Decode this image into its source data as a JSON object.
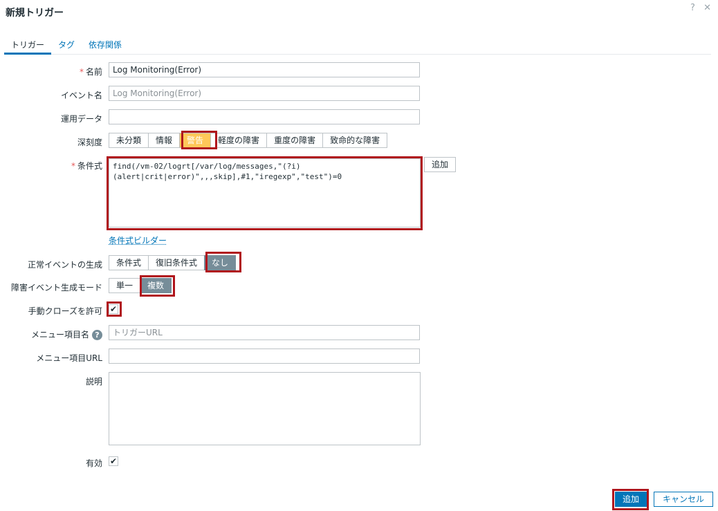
{
  "dialog": {
    "title": "新規トリガー",
    "help_icon": "?",
    "close_icon": "✕"
  },
  "tabs": [
    "トリガー",
    "タグ",
    "依存関係"
  ],
  "form": {
    "name": {
      "label": "名前",
      "value": "Log Monitoring(Error)"
    },
    "event_name": {
      "label": "イベント名",
      "placeholder": "Log Monitoring(Error)"
    },
    "opdata": {
      "label": "運用データ",
      "value": ""
    },
    "severity": {
      "label": "深刻度",
      "options": [
        "未分類",
        "情報",
        "警告",
        "軽度の障害",
        "重度の障害",
        "致命的な障害"
      ],
      "selected": "警告"
    },
    "expression": {
      "label": "条件式",
      "value": "find(/vm-02/logrt[/var/log/messages,\"(?i)(alert|crit|error)\",,,skip],#1,\"iregexp\",\"test\")=0",
      "add_button": "追加",
      "builder_link": "条件式ビルダー"
    },
    "ok_event": {
      "label": "正常イベントの生成",
      "options": [
        "条件式",
        "復旧条件式",
        "なし"
      ],
      "selected": "なし"
    },
    "problem_mode": {
      "label": "障害イベント生成モード",
      "options": [
        "単一",
        "複数"
      ],
      "selected": "複数"
    },
    "manual_close": {
      "label": "手動クローズを許可",
      "checked": true
    },
    "url_name": {
      "label": "メニュー項目名",
      "placeholder": "トリガーURL"
    },
    "url": {
      "label": "メニュー項目URL",
      "value": ""
    },
    "description": {
      "label": "説明",
      "value": ""
    },
    "enabled": {
      "label": "有効",
      "checked": true
    }
  },
  "footer": {
    "add": "追加",
    "cancel": "キャンセル"
  },
  "colors": {
    "accent": "#0275b8",
    "warning": "#ffc859",
    "selected_gray": "#768d99",
    "highlight_red": "#b0151c"
  }
}
